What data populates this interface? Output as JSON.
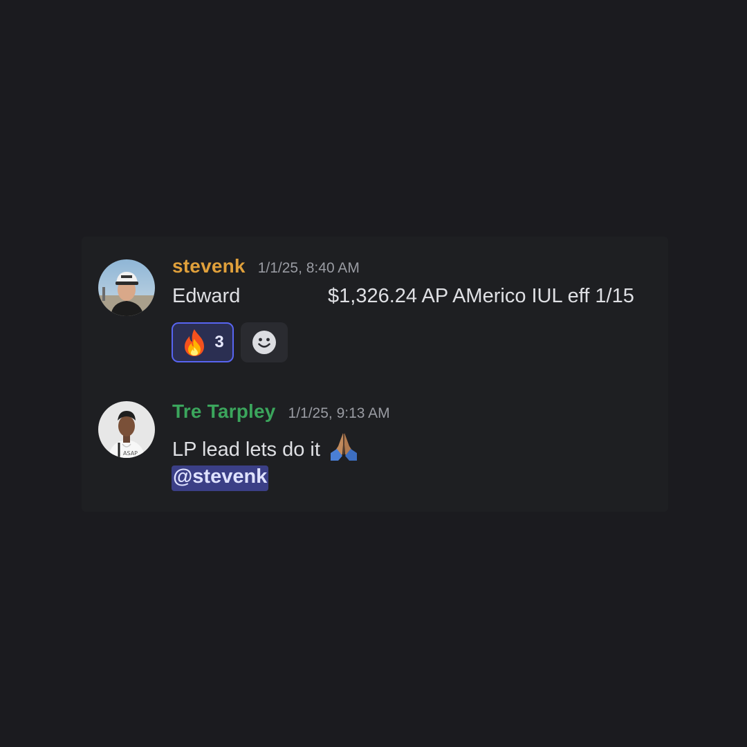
{
  "messages": [
    {
      "username": "stevenk",
      "username_color": "#e0a03b",
      "timestamp": "1/1/25, 8:40 AM",
      "body_left": "Edward",
      "body_right": "$1,326.24 AP AMerico IUL eff 1/15",
      "reactions": [
        {
          "emoji_icon": "fire-emoji-icon",
          "count": "3"
        }
      ],
      "add_reaction_icon": "smiley-add-reaction-icon"
    },
    {
      "username": "Tre Tarpley",
      "username_color": "#3ba55c",
      "timestamp": "1/1/25, 9:13 AM",
      "body": "LP lead lets do it",
      "body_emoji_icon": "folded-hands-emoji-icon",
      "mention": "@stevenk"
    }
  ],
  "colors": {
    "background": "#1b1b1f",
    "mention_bg": "#3b3f86",
    "reaction_border": "#5865f2"
  }
}
